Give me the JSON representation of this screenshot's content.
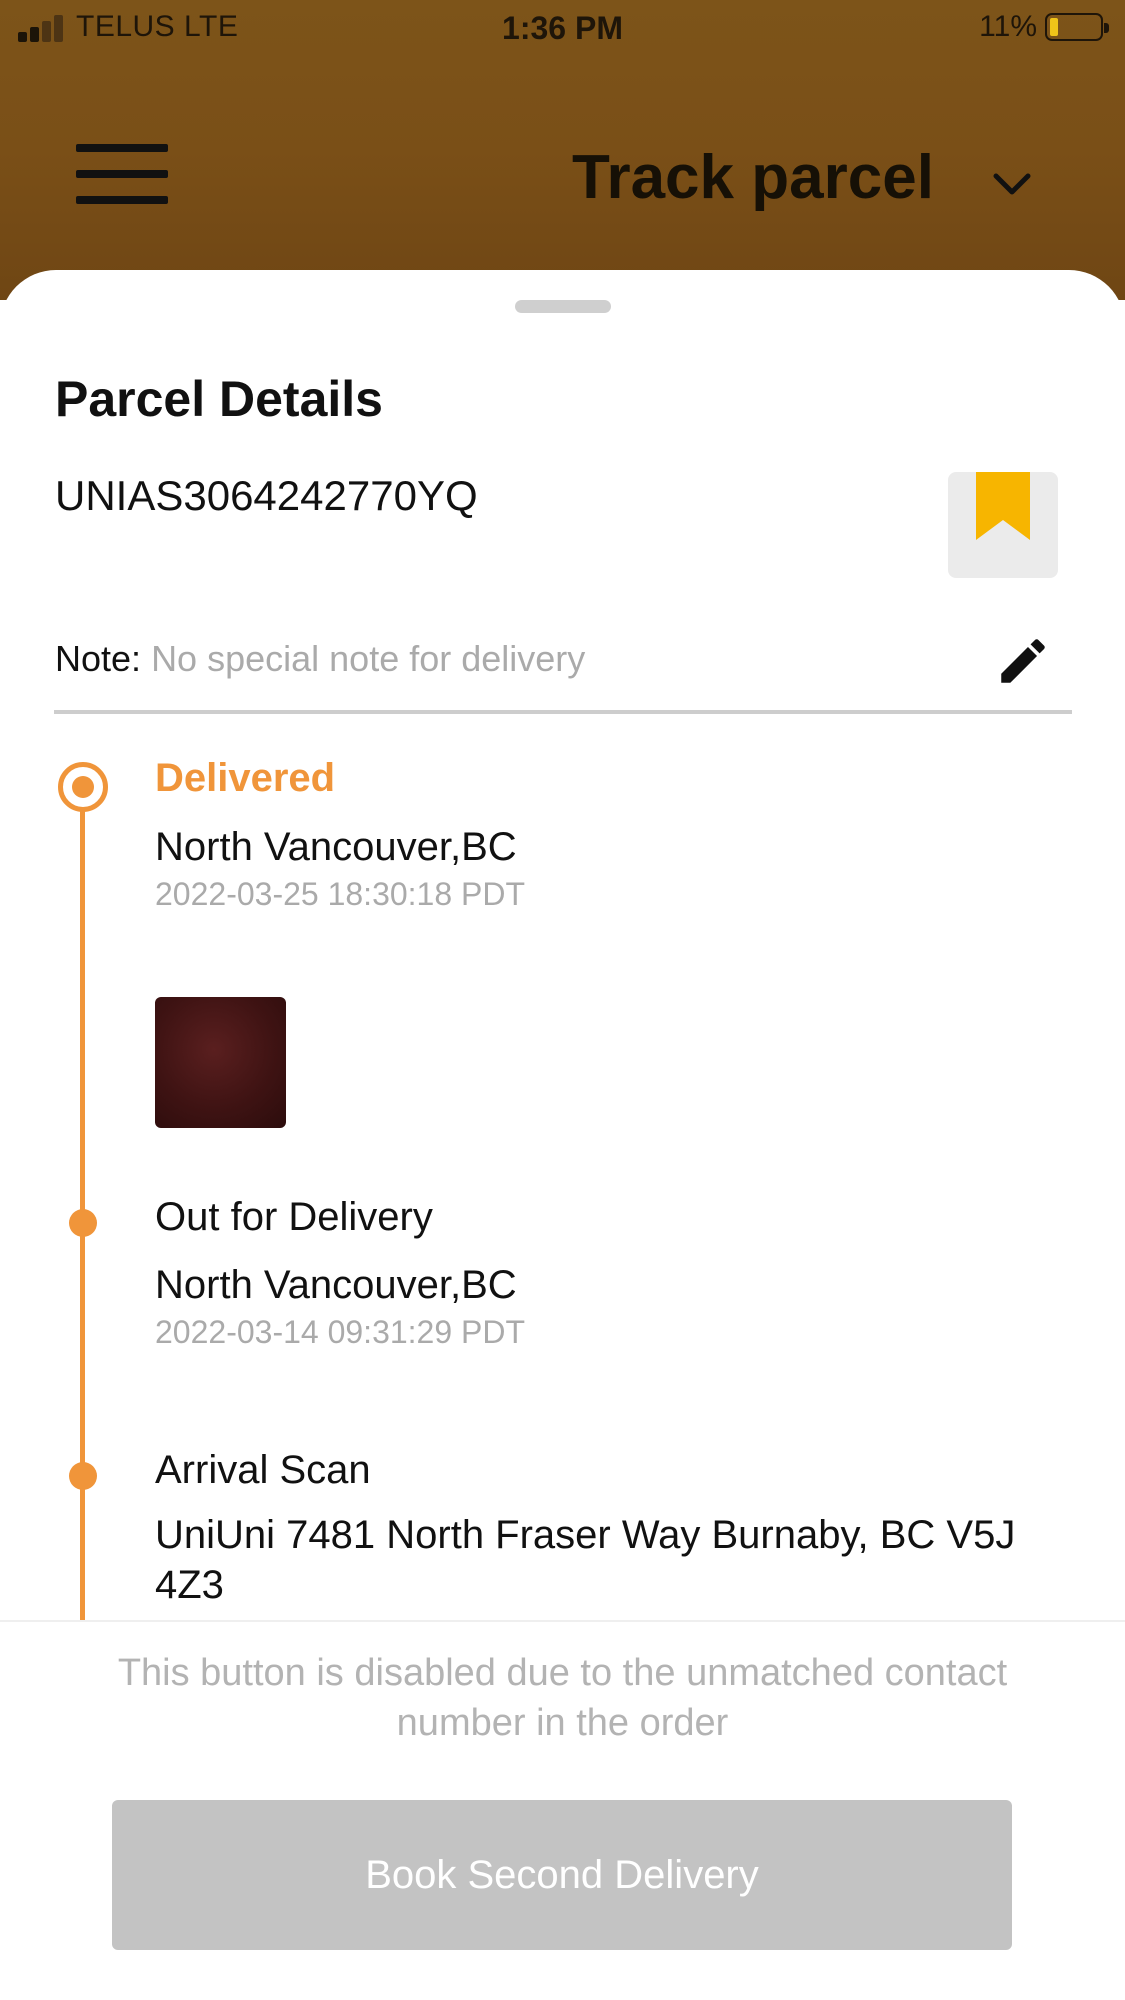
{
  "status_bar": {
    "carrier": "TELUS  LTE",
    "time": "1:36 PM",
    "battery_percent": "11%",
    "battery_level": 0.11
  },
  "header": {
    "title": "Track parcel",
    "menu_icon": "hamburger-menu-icon",
    "dropdown_icon": "chevron-down-icon"
  },
  "parcel": {
    "section_title": "Parcel Details",
    "tracking_number": "UNIAS3064242770YQ",
    "bookmark_icon": "bookmark-icon",
    "note_label": "Note:",
    "note_value": "No special note for delivery",
    "edit_icon": "pencil-icon"
  },
  "timeline": [
    {
      "status": "Delivered",
      "location": "North Vancouver,BC",
      "time": "2022-03-25 18:30:18 PDT",
      "has_photo": true
    },
    {
      "status": "Out for Delivery",
      "location": "North Vancouver,BC",
      "time": "2022-03-14 09:31:29 PDT"
    },
    {
      "status": "Arrival Scan",
      "location": "UniUni 7481 North Fraser Way Burnaby, BC V5J 4Z3"
    }
  ],
  "footer": {
    "disabled_message": "This button is disabled due to the unmatched contact number in the order",
    "book_button_label": "Book Second Delivery"
  },
  "colors": {
    "header_brown": "#7a4f17",
    "accent_orange": "#f0953a",
    "bookmark_yellow": "#f7b500",
    "disabled_gray": "#c3c3c3"
  }
}
